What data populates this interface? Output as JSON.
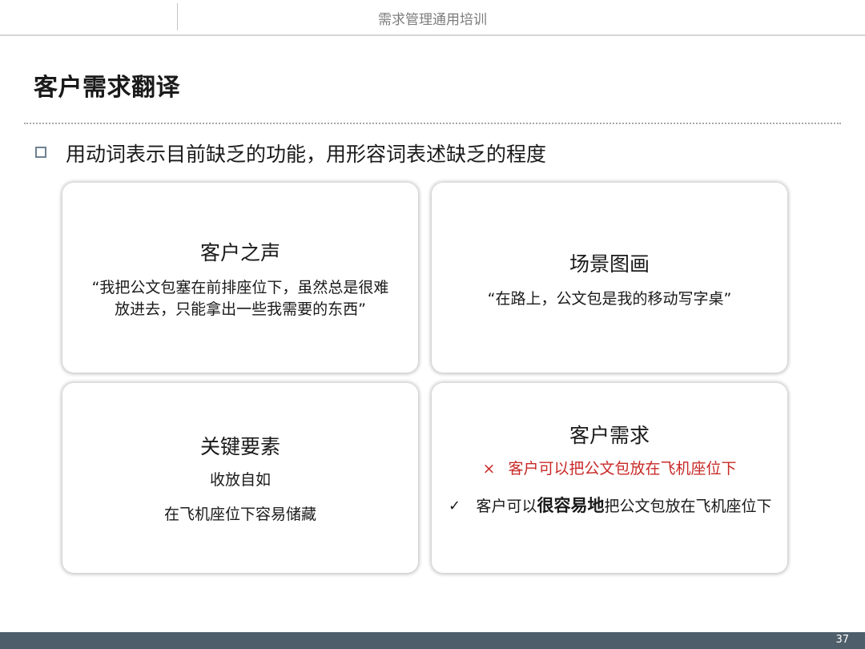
{
  "header": {
    "title": "需求管理通用培训"
  },
  "slide": {
    "title": "客户需求翻译",
    "bullet": "用动词表示目前缺乏的功能，用形容词表述缺乏的程度"
  },
  "cards": {
    "voice": {
      "title": "客户之声",
      "line1": "“我把公文包塞在前排座位下，虽然总是很难",
      "line2": "放进去，只能拿出一些我需要的东西”"
    },
    "scene": {
      "title": "场景图画",
      "line1": "“在路上，公文包是我的移动写字桌”"
    },
    "elements": {
      "title": "关键要素",
      "line1": "收放自如",
      "line2": "在飞机座位下容易储藏"
    },
    "need": {
      "title": "客户需求",
      "wrong_mark": "×",
      "wrong_text": "客户可以把公文包放在飞机座位下",
      "right_mark": "✓",
      "right_prefix": "客户可以",
      "right_bold": "很容易地",
      "right_suffix": "把公文包放在飞机座位下"
    }
  },
  "footer": {
    "page_number": "37"
  },
  "colors": {
    "footer_bar": "#4e5e6b",
    "wrong_red": "#c82a28",
    "bullet_border": "#6f8190"
  }
}
